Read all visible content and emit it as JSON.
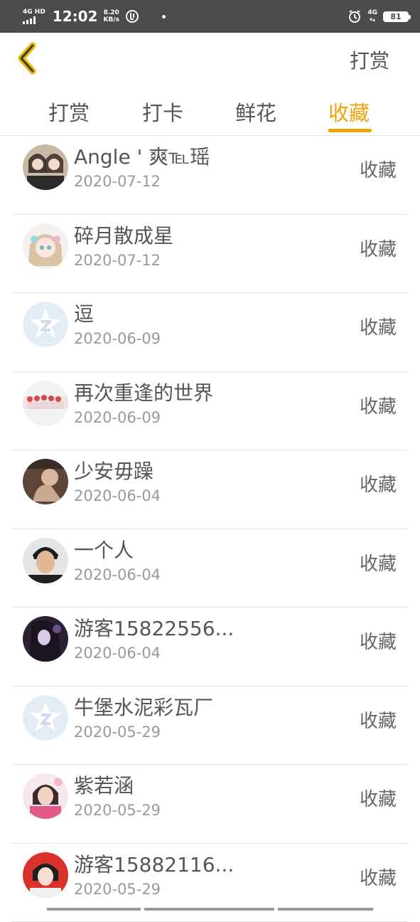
{
  "status_bar": {
    "network_left": "4G HD",
    "time": "12:02",
    "speed_value": "8.20",
    "speed_unit": "KB/s",
    "network_right": "4G",
    "battery": "81"
  },
  "header": {
    "back_icon": "chevron-left-icon",
    "title": "打赏"
  },
  "tabs": [
    {
      "label": "打赏",
      "active": false
    },
    {
      "label": "打卡",
      "active": false
    },
    {
      "label": "鲜花",
      "active": false
    },
    {
      "label": "收藏",
      "active": true
    }
  ],
  "colors": {
    "accent": "#f0a40a",
    "text": "#555555",
    "muted": "#999999"
  },
  "items": [
    {
      "name": "Angle ' 爽℡瑶",
      "date": "2020-07-12",
      "action": "收藏",
      "avatar": "photo-two-girls"
    },
    {
      "name": "碎月散成星",
      "date": "2020-07-12",
      "action": "收藏",
      "avatar": "anime-girl"
    },
    {
      "name": "逗",
      "date": "2020-06-09",
      "action": "收藏",
      "avatar": "default-star"
    },
    {
      "name": "再次重逢的世界",
      "date": "2020-06-09",
      "action": "收藏",
      "avatar": "group-photo"
    },
    {
      "name": "少安毋躁",
      "date": "2020-06-04",
      "action": "收藏",
      "avatar": "photo-couple"
    },
    {
      "name": "一个人",
      "date": "2020-06-04",
      "action": "收藏",
      "avatar": "photo-man"
    },
    {
      "name": "游客15822556...",
      "date": "2020-06-04",
      "action": "收藏",
      "avatar": "anime-dark"
    },
    {
      "name": "牛堡水泥彩瓦厂",
      "date": "2020-05-29",
      "action": "收藏",
      "avatar": "default-star"
    },
    {
      "name": "紫若涵",
      "date": "2020-05-29",
      "action": "收藏",
      "avatar": "photo-girl-pink"
    },
    {
      "name": "游客15882116...",
      "date": "2020-05-29",
      "action": "收藏",
      "avatar": "photo-red-bg"
    }
  ]
}
